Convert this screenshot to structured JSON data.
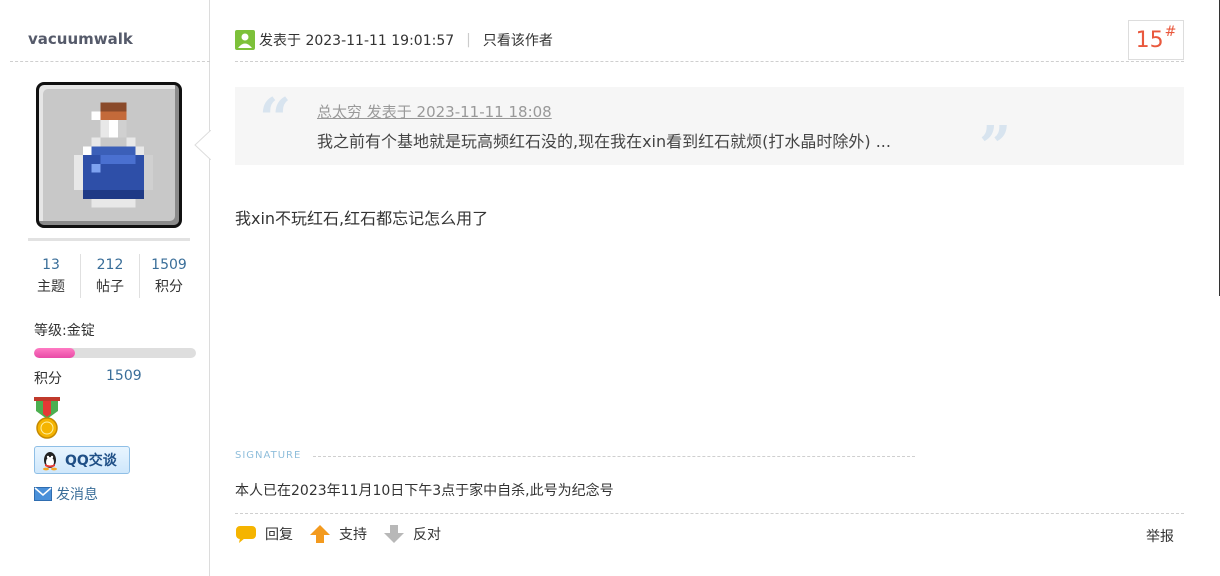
{
  "user": {
    "name": "vacuumwalk",
    "stats": [
      {
        "value": "13",
        "label": "主题"
      },
      {
        "value": "212",
        "label": "帖子"
      },
      {
        "value": "1509",
        "label": "积分"
      }
    ],
    "level_text": "等级:金锭",
    "level_progress_percent": 25,
    "points_label": "积分",
    "points_value": "1509",
    "qq_label": "QQ交谈",
    "message_label": "发消息"
  },
  "post": {
    "posted_at": "发表于 2023-11-11 19:01:57",
    "author_only": "只看该作者",
    "floor_number": "15",
    "floor_symbol": "#",
    "quote": {
      "meta": "总太穷 发表于 2023-11-11 18:08",
      "text": "我之前有个基地就是玩高频红石没的,现在我在xin看到红石就烦(打水晶时除外) ..."
    },
    "content": "我xin不玩红石,红石都忘记怎么用了",
    "signature_label": "SIGNATURE",
    "signature": "本人已在2023年11月10日下午3点于家中自杀,此号为纪念号"
  },
  "actions": {
    "reply": "回复",
    "support": "支持",
    "oppose": "反对",
    "report": "举报"
  }
}
